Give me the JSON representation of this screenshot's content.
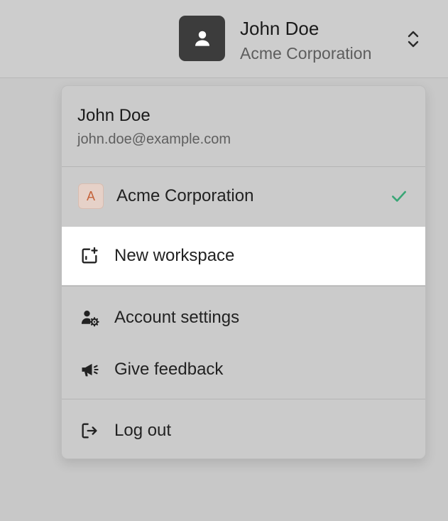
{
  "topbar": {
    "user_name": "John Doe",
    "org_name": "Acme Corporation",
    "avatar_icon": "user-icon",
    "switch_icon": "chevron-up-down-icon"
  },
  "menu": {
    "header": {
      "name": "John Doe",
      "email": "john.doe@example.com"
    },
    "workspace": {
      "badge_letter": "A",
      "label": "Acme Corporation",
      "selected_icon": "check-icon",
      "check_color": "#3aa676"
    },
    "new_workspace": {
      "label": "New workspace",
      "icon": "add-square-icon"
    },
    "account_settings": {
      "label": "Account settings",
      "icon": "user-gear-icon"
    },
    "give_feedback": {
      "label": "Give feedback",
      "icon": "megaphone-icon"
    },
    "log_out": {
      "label": "Log out",
      "icon": "logout-icon"
    }
  }
}
